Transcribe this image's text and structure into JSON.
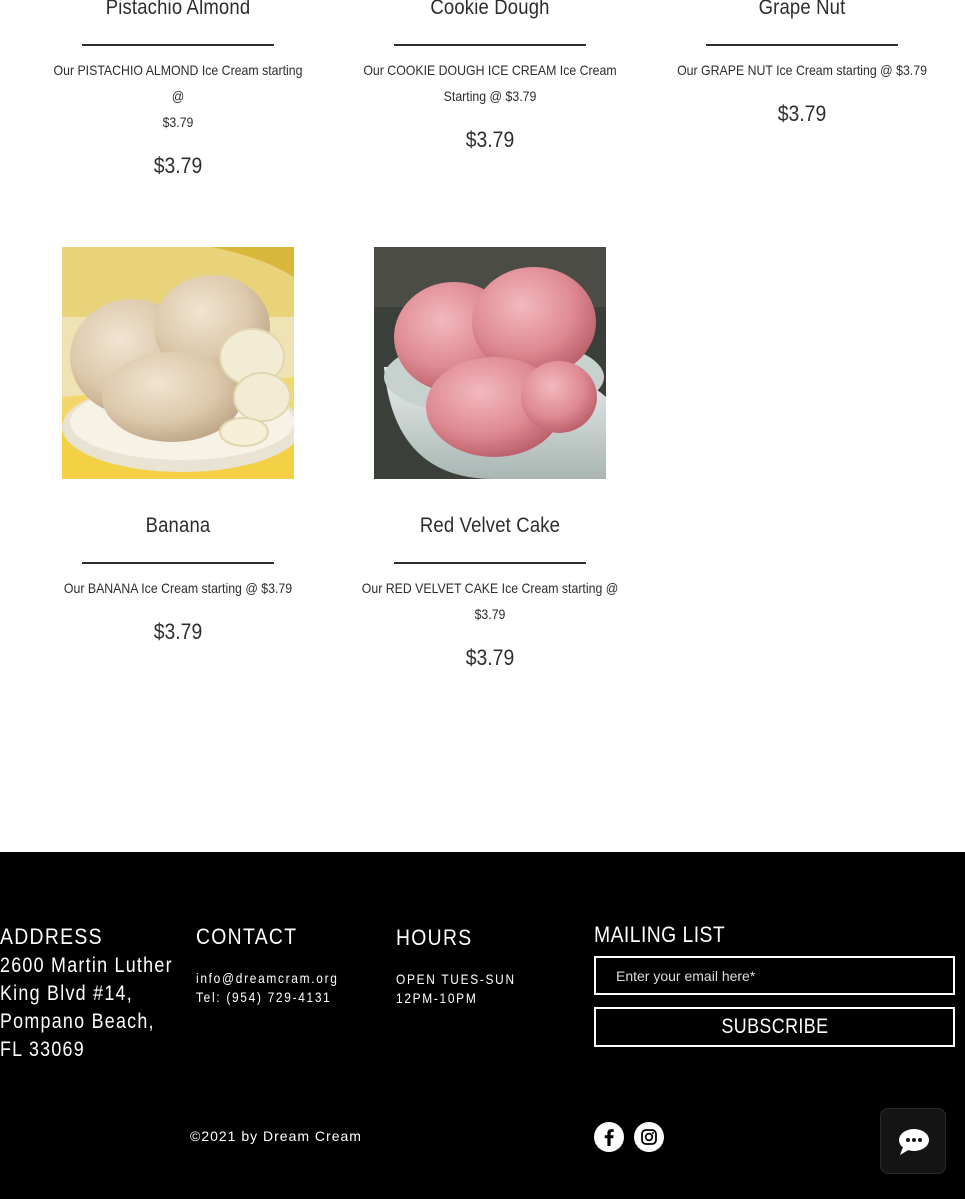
{
  "products": [
    {
      "name": "Pistachio Almond",
      "desc_lines": [
        "Our PISTACHIO ALMOND Ice Cream starting @",
        "$3.79"
      ],
      "price": "$3.79"
    },
    {
      "name": "Cookie Dough",
      "desc_lines": [
        "Our COOKIE DOUGH ICE CREAM Ice Cream",
        "Starting @ $3.79"
      ],
      "price": "$3.79"
    },
    {
      "name": "Grape Nut",
      "desc_lines": [
        "Our GRAPE NUT Ice Cream starting @ $3.79"
      ],
      "price": "$3.79"
    },
    {
      "name": "Banana",
      "desc_lines": [
        "Our BANANA Ice Cream starting @ $3.79"
      ],
      "price": "$3.79"
    },
    {
      "name": "Red Velvet Cake",
      "desc_lines": [
        "Our RED VELVET CAKE Ice Cream starting @",
        "$3.79"
      ],
      "price": "$3.79"
    }
  ],
  "footer": {
    "address": {
      "heading": "ADDRESS",
      "body": "2600 Martin Luther King Blvd #14, Pompano Beach, FL 33069"
    },
    "contact": {
      "heading": "CONTACT",
      "email": "info@dreamcram.org",
      "phone": "Tel: (954) 729-4131"
    },
    "hours": {
      "heading": "HOURS",
      "line1": "OPEN TUES-SUN",
      "line2": "12PM-10PM"
    },
    "mailing": {
      "heading": "MAILING LIST",
      "placeholder": "Enter your email here*",
      "button": "SUBSCRIBE"
    },
    "copyright": "©2021 by Dream Cream",
    "social": [
      "facebook-icon",
      "instagram-icon"
    ]
  },
  "chat": {
    "icon": "chat-bubble-icon"
  },
  "colors": {
    "footer_bg": "#000000",
    "text": "#2d2d2d",
    "accent_white": "#ffffff"
  }
}
